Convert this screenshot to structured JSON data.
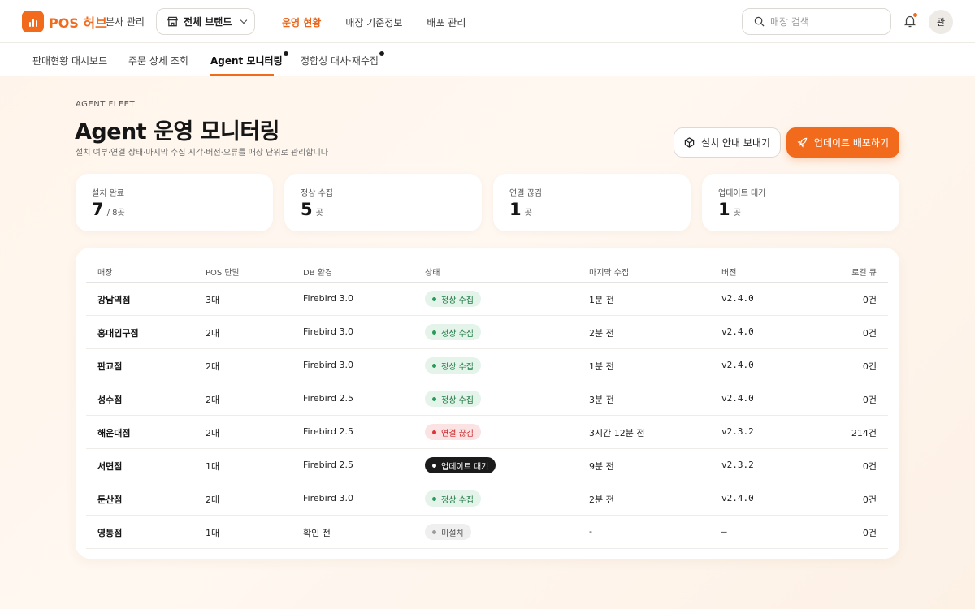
{
  "app": {
    "name": "POS 허브",
    "section": "본사 관리",
    "brand_select": "전체 브랜드",
    "top_nav": [
      "운영 현황",
      "매장 기준정보",
      "배포 관리"
    ],
    "active_top_nav": "운영 현황",
    "search_placeholder": "매장 검색",
    "avatar": "관",
    "accent_color": "#f26b1d",
    "icons": {
      "logo": "bar-chart-icon",
      "store": "store-icon",
      "search": "search-icon",
      "bell": "bell-icon",
      "send": "package-icon",
      "deploy": "rocket-icon"
    }
  },
  "sub_tabs": [
    {
      "label": "판매현황 대시보드",
      "active": false,
      "dot": false
    },
    {
      "label": "주문 상세 조회",
      "active": false,
      "dot": false
    },
    {
      "label": "Agent 모니터링",
      "active": true,
      "dot": true
    },
    {
      "label": "정합성 대사·재수집",
      "active": false,
      "dot": true
    }
  ],
  "header": {
    "eyebrow": "AGENT FLEET",
    "title": "Agent 운영 모니터링",
    "description": "설치 여부·연결 상태·마지막 수집 시각·버전·오류를 매장 단위로 관리합니다",
    "btn_send_guide": "설치 안내 보내기",
    "btn_deploy": "업데이트 배포하기"
  },
  "stats": [
    {
      "label": "설치 완료",
      "value": "7",
      "unit": "/ 8곳"
    },
    {
      "label": "정상 수집",
      "value": "5",
      "unit": "곳"
    },
    {
      "label": "연결 끊김",
      "value": "1",
      "unit": "곳"
    },
    {
      "label": "업데이트 대기",
      "value": "1",
      "unit": "곳"
    }
  ],
  "table": {
    "columns": [
      "매장",
      "POS 단말",
      "DB 환경",
      "상태",
      "마지막 수집",
      "버전",
      "로컬 큐"
    ],
    "rows": [
      {
        "store": "강남역점",
        "pos": "3대",
        "db": "Firebird 3.0",
        "status": "정상 수집",
        "status_type": "ok",
        "last": "1분 전",
        "version": "v2.4.0",
        "queue": "0건"
      },
      {
        "store": "홍대입구점",
        "pos": "2대",
        "db": "Firebird 3.0",
        "status": "정상 수집",
        "status_type": "ok",
        "last": "2분 전",
        "version": "v2.4.0",
        "queue": "0건"
      },
      {
        "store": "판교점",
        "pos": "2대",
        "db": "Firebird 3.0",
        "status": "정상 수집",
        "status_type": "ok",
        "last": "1분 전",
        "version": "v2.4.0",
        "queue": "0건"
      },
      {
        "store": "성수점",
        "pos": "2대",
        "db": "Firebird 2.5",
        "status": "정상 수집",
        "status_type": "ok",
        "last": "3분 전",
        "version": "v2.4.0",
        "queue": "0건"
      },
      {
        "store": "해운대점",
        "pos": "2대",
        "db": "Firebird 2.5",
        "status": "연결 끊김",
        "status_type": "bad",
        "last": "3시간 12분 전",
        "version": "v2.3.2",
        "queue": "214건"
      },
      {
        "store": "서면점",
        "pos": "1대",
        "db": "Firebird 2.5",
        "status": "업데이트 대기",
        "status_type": "dark",
        "last": "9분 전",
        "version": "v2.3.2",
        "queue": "0건"
      },
      {
        "store": "둔산점",
        "pos": "2대",
        "db": "Firebird 3.0",
        "status": "정상 수집",
        "status_type": "ok",
        "last": "2분 전",
        "version": "v2.4.0",
        "queue": "0건"
      },
      {
        "store": "영통점",
        "pos": "1대",
        "db": "확인 전",
        "status": "미설치",
        "status_type": "none",
        "last": "-",
        "version": "–",
        "queue": "0건"
      }
    ]
  }
}
